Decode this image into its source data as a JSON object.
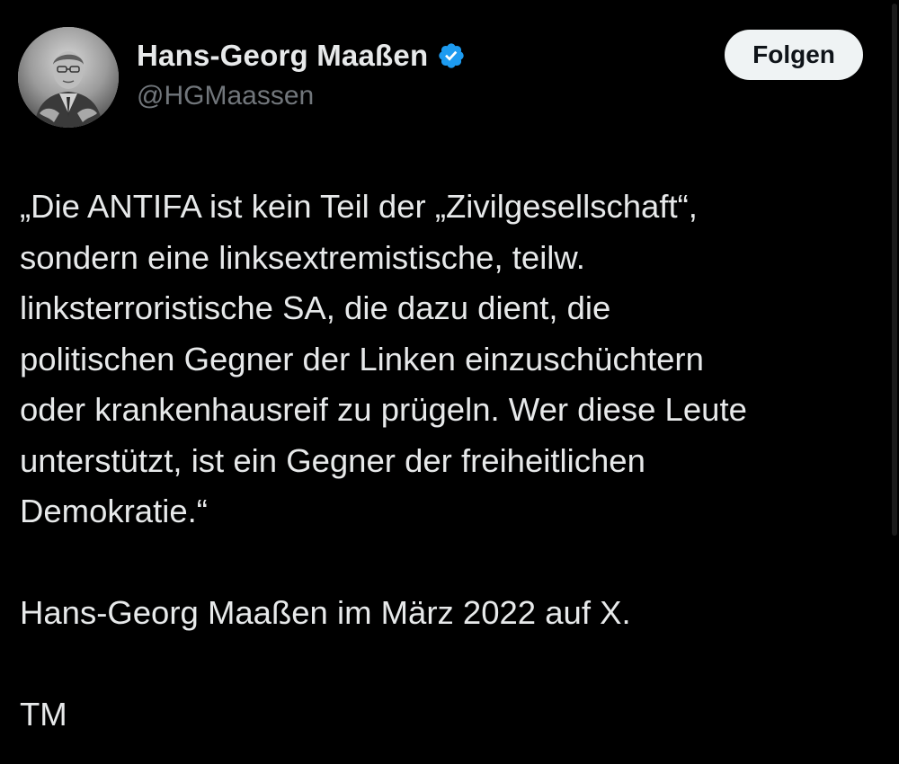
{
  "author": {
    "display_name": "Hans-Georg Maaßen",
    "handle": "@HGMaassen",
    "avatar_icon": "profile-photo",
    "verified_icon": "verified-badge-icon",
    "verified_color": "#1d9bf0"
  },
  "actions": {
    "follow_label": "Folgen"
  },
  "tweet": {
    "lines": [
      "„Die ANTIFA ist kein Teil der „Zivilgesellschaft“,",
      "sondern eine linksextremistische, teilw.",
      "linksterroristische SA, die dazu dient, die",
      "politischen Gegner der Linken einzuschüchtern",
      "oder krankenhausreif zu prügeln. Wer diese Leute",
      "unterstützt, ist ein Gegner der freiheitlichen",
      "Demokratie.“",
      "",
      "Hans-Georg Maaßen im März 2022 auf X.",
      "",
      "TM"
    ]
  },
  "colors": {
    "background": "#000000",
    "text": "#e7e9ea",
    "secondary_text": "#71767b",
    "button_bg": "#eff3f4",
    "button_text": "#0f1419"
  }
}
